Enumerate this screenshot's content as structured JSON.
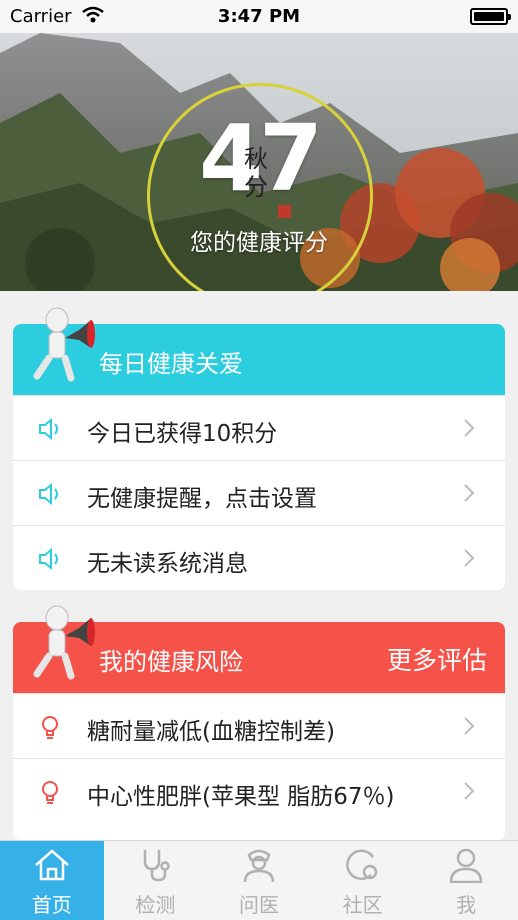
{
  "status_bar": {
    "carrier": "Carrier",
    "time": "3:47 PM"
  },
  "hero": {
    "score": "47",
    "seal_text": "秋分",
    "caption": "您的健康评分"
  },
  "daily_care": {
    "title": "每日健康关爱",
    "color": "#2dcde0",
    "icon": "speaker-icon",
    "items": [
      {
        "label": "今日已获得10积分"
      },
      {
        "label": "无健康提醒，点击设置"
      },
      {
        "label": "无未读系统消息"
      }
    ]
  },
  "risks": {
    "title": "我的健康风险",
    "action": "更多评估",
    "color": "#f5534a",
    "icon": "lightbulb-icon",
    "items": [
      {
        "label": "糖耐量减低(血糖控制差)"
      },
      {
        "label": "中心性肥胖(苹果型 脂肪67％)"
      }
    ]
  },
  "tabs": [
    {
      "label": "首页",
      "icon": "home-icon",
      "active": true
    },
    {
      "label": "检测",
      "icon": "stethoscope-icon",
      "active": false
    },
    {
      "label": "问医",
      "icon": "doctor-icon",
      "active": false
    },
    {
      "label": "社区",
      "icon": "community-icon",
      "active": false
    },
    {
      "label": "我",
      "icon": "person-icon",
      "active": false
    }
  ],
  "colors": {
    "accent_blue": "#36b1e8",
    "ring": "#d8d23a"
  }
}
